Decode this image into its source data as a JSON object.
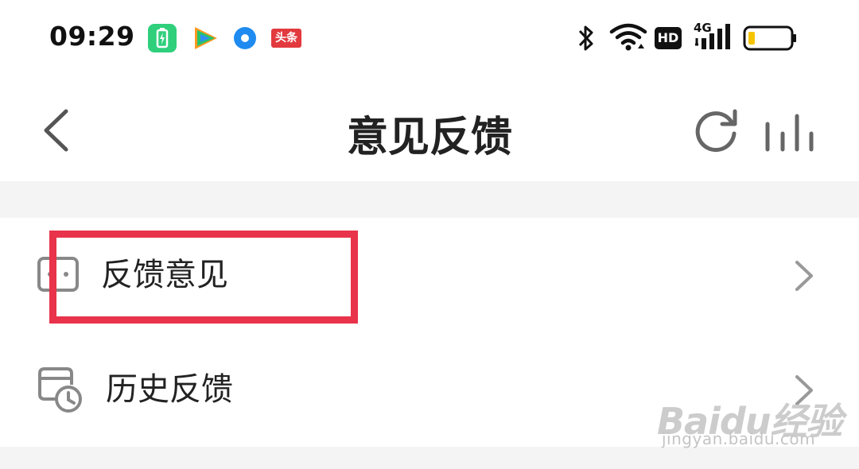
{
  "status_bar": {
    "time": "09:29",
    "notification_icons": [
      "battery-saver-app-icon",
      "tencent-video-icon",
      "blue-dot-app-icon",
      "toutiao-icon"
    ],
    "toutiao_label": "头条",
    "hd_label": "HD",
    "network_label": "4G",
    "battery_color": "#f5c400"
  },
  "nav": {
    "title": "意见反馈",
    "back_icon": "chevron-left-icon",
    "refresh_icon": "refresh-icon",
    "stats_icon": "bar-chart-icon"
  },
  "list": {
    "items": [
      {
        "label": "反馈意见",
        "icon": "feedback-icon"
      },
      {
        "label": "历史反馈",
        "icon": "history-clock-icon"
      }
    ]
  },
  "annotation": {
    "color": "#e8334a"
  },
  "watermark": {
    "logo": "Baidu经验",
    "url": "jingyan.baidu.com"
  }
}
